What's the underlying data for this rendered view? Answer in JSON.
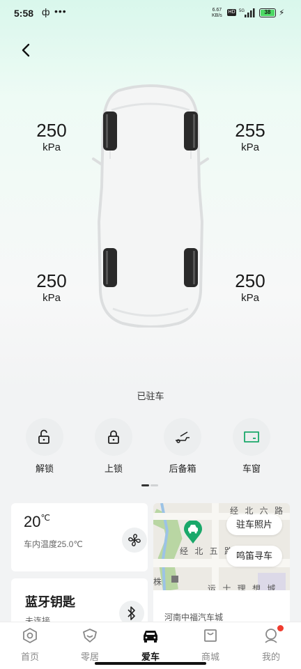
{
  "status_bar": {
    "time": "5:58",
    "app_glyph": "ф",
    "dots": "•••",
    "net_speed": "6.67",
    "net_unit": "KB/s",
    "hd": "HD",
    "signal": "5G",
    "battery": "38"
  },
  "tires": {
    "front_left": {
      "value": "250",
      "unit": "kPa"
    },
    "front_right": {
      "value": "255",
      "unit": "kPa"
    },
    "rear_left": {
      "value": "250",
      "unit": "kPa"
    },
    "rear_right": {
      "value": "250",
      "unit": "kPa"
    }
  },
  "vehicle_status": "已驻车",
  "controls": [
    {
      "label": "解锁",
      "icon": "unlock-icon"
    },
    {
      "label": "上锁",
      "icon": "lock-icon"
    },
    {
      "label": "后备箱",
      "icon": "trunk-icon"
    },
    {
      "label": "车窗",
      "icon": "window-icon"
    }
  ],
  "climate": {
    "set_temp": "20",
    "set_unit": "℃",
    "inside_temp": "车内温度25.0℃"
  },
  "bluetooth_key": {
    "title": "蓝牙钥匙",
    "status": "未连接"
  },
  "map": {
    "road1": "经 北 六 路",
    "road2": "经 北 五 路",
    "road3": "运 士 理 想 城",
    "poi": "株",
    "photo_button": "驻车照片",
    "honk_button": "鸣笛寻车",
    "address": "河南中福汽车城"
  },
  "tabbar": [
    {
      "label": "首页",
      "icon": "home-icon"
    },
    {
      "label": "零居",
      "icon": "community-icon"
    },
    {
      "label": "爱车",
      "icon": "car-icon"
    },
    {
      "label": "商城",
      "icon": "shop-icon"
    },
    {
      "label": "我的",
      "icon": "profile-icon"
    }
  ],
  "colors": {
    "accent_green": "#1aa86a",
    "header_gradient_top": "#d9f7ec",
    "badge_red": "#f03c2e"
  }
}
